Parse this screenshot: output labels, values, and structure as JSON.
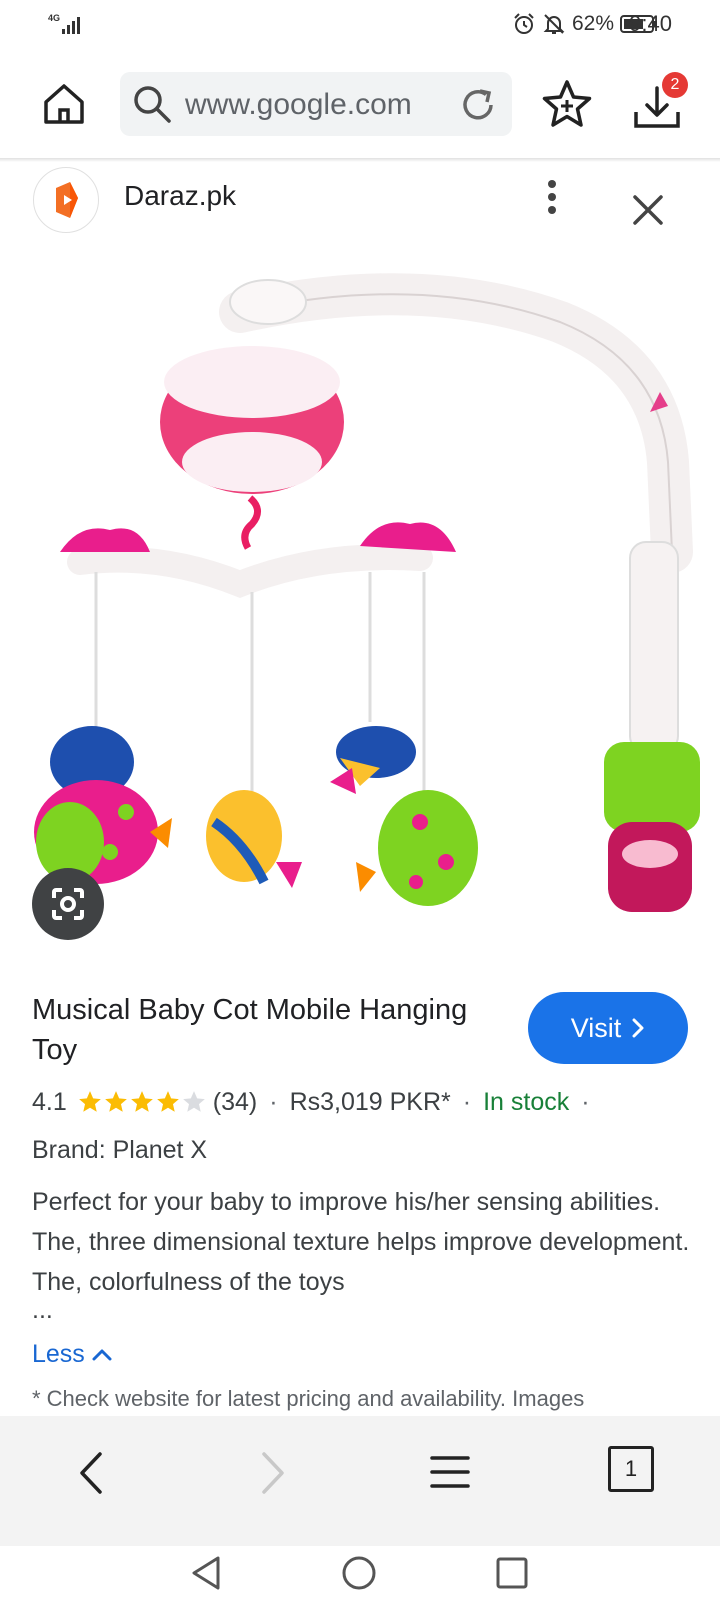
{
  "status_bar": {
    "network": "4G",
    "battery": "62%",
    "time": "9:40"
  },
  "toolbar": {
    "url": "www.google.com",
    "download_badge": "2"
  },
  "source": {
    "name": "Daraz.pk"
  },
  "product": {
    "title": "Musical Baby Cot Mobile Hanging Toy",
    "visit_label": "Visit",
    "rating": "4.1",
    "rating_value": 4.1,
    "rating_max": 5,
    "review_count": "(34)",
    "price": "Rs3,019 PKR*",
    "availability": "In stock",
    "brand": "Brand: Planet X",
    "description": "Perfect for your baby to improve his/her sensing abilities. The, three dimensional texture helps improve development. The, colorfulness of the toys",
    "ellipsis": "...",
    "less_label": "Less",
    "disclaimer": "* Check website for latest pricing and availability. Images"
  },
  "bottom_nav": {
    "tab_count": "1"
  },
  "colors": {
    "accent_blue": "#1a73e8",
    "link_blue": "#1967d2",
    "in_stock_green": "#188038",
    "star_gold": "#fbbc04",
    "badge_red": "#e53935"
  },
  "icons": [
    "signal-icon",
    "alarm-icon",
    "mute-icon",
    "battery-icon",
    "home-icon",
    "search-icon",
    "reload-icon",
    "star-icon",
    "download-icon",
    "daraz-logo",
    "more-vert-icon",
    "close-icon",
    "lens-icon",
    "chevron-right-icon",
    "chevron-up-icon",
    "back-icon",
    "forward-icon",
    "menu-icon",
    "tabs-icon",
    "sys-back-icon",
    "sys-home-icon",
    "sys-recent-icon"
  ]
}
